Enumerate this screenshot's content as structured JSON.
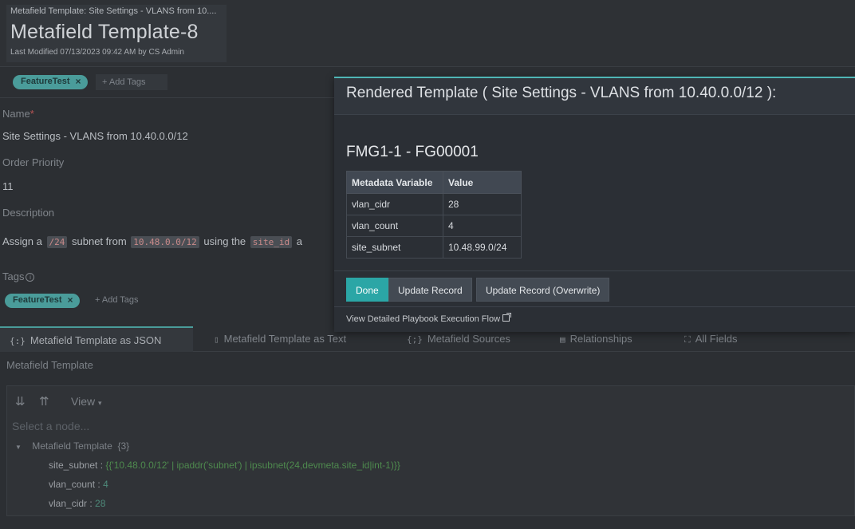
{
  "header": {
    "breadcrumb": "Metafield Template: Site Settings - VLANS from 10....",
    "title": "Metafield Template-8",
    "last_modified": "Last Modified 07/13/2023 09:42 AM by CS Admin"
  },
  "tags_bar": {
    "tag": "FeatureTest",
    "remove_icon": "×",
    "add_tags": "+ Add Tags"
  },
  "form": {
    "name_label": "Name",
    "name_required_mark": "*",
    "name_value": "Site Settings - VLANS from 10.40.0.0/12",
    "order_label": "Order Priority",
    "order_value": "11",
    "description_label": "Description",
    "description": {
      "part1": "Assign a",
      "code1": "/24",
      "part2": "subnet from",
      "code2": "10.48.0.0/12",
      "part3": "using the",
      "code3": "site_id",
      "part4": "a"
    },
    "tags_label": "Tags",
    "info_icon": "i",
    "tag": "FeatureTest",
    "remove_icon": "×",
    "add_tags": "+ Add Tags"
  },
  "tabs": [
    {
      "icon": "{:}",
      "label": "Metafield Template as JSON",
      "active": true
    },
    {
      "icon": "▯",
      "label": "Metafield Template as Text"
    },
    {
      "icon": "{;}",
      "label": "Metafield Sources"
    },
    {
      "icon": "▤",
      "label": "Relationships"
    },
    {
      "icon": "⛶",
      "label": "All Fields"
    }
  ],
  "tree": {
    "section_label": "Metafield Template",
    "view_label": "View",
    "view_caret": "▾",
    "expand_icon": "⇊",
    "collapse_icon": "⇈",
    "select_placeholder": "Select a node...",
    "root_caret": "▼",
    "root_label": "Metafield Template",
    "root_count": "{3}",
    "rows": [
      {
        "key": "site_subnet",
        "sep": " : ",
        "value": "{{'10.48.0.0/12' | ipaddr('subnet') | ipsubnet(24,devmeta.site_id|int-1)}}"
      },
      {
        "key": "vlan_count",
        "sep": " : ",
        "value": "4"
      },
      {
        "key": "vlan_cidr",
        "sep": " : ",
        "value": "28"
      }
    ]
  },
  "modal": {
    "title": "Rendered Template ( Site Settings - VLANS from 10.40.0.0/12 ):",
    "device": "FMG1-1 - FG00001",
    "table": {
      "headers": [
        "Metadata Variable",
        "Value"
      ],
      "rows": [
        [
          "vlan_cidr",
          "28"
        ],
        [
          "vlan_count",
          "4"
        ],
        [
          "site_subnet",
          "10.48.99.0/24"
        ]
      ]
    },
    "buttons": {
      "done": "Done",
      "update": "Update Record",
      "overwrite": "Update Record (Overwrite)"
    },
    "footer_link": "View Detailed Playbook Execution Flow"
  },
  "colors": {
    "accent": "#2ba6a6",
    "tag": "#4a9c9a",
    "modal_bg": "#2b2f35"
  }
}
